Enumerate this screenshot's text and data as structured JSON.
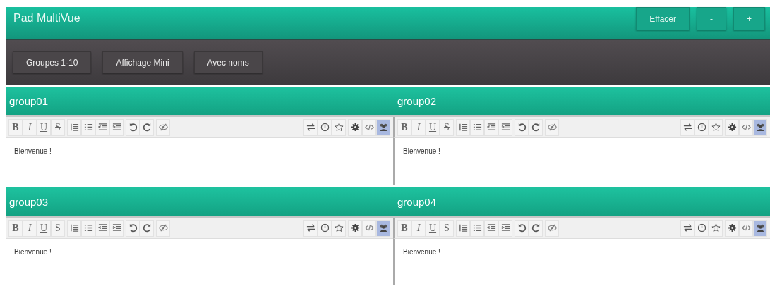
{
  "header": {
    "title": "Pad MultiVue",
    "buttons": [
      "Effacer",
      "-",
      "+"
    ]
  },
  "nav": {
    "buttons": [
      "Groupes 1-10",
      "Affichage Mini",
      "Avec noms"
    ]
  },
  "groups": [
    {
      "name": "group01",
      "format_buttons": [
        "B",
        "I",
        "U",
        "S"
      ],
      "content": "Bienvenue !",
      "users_toggle_on": true
    },
    {
      "name": "group02",
      "format_buttons": [
        "B",
        "I",
        "U",
        "S"
      ],
      "content": "Bienvenue !",
      "users_toggle_on": true
    },
    {
      "name": "group03",
      "format_buttons": [
        "B",
        "I",
        "U",
        "S"
      ],
      "content": "Bienvenue !",
      "users_toggle_on": true
    },
    {
      "name": "group04",
      "format_buttons": [
        "B",
        "I",
        "U",
        "S"
      ],
      "content": "Bienvenue !",
      "users_toggle_on": true
    }
  ]
}
